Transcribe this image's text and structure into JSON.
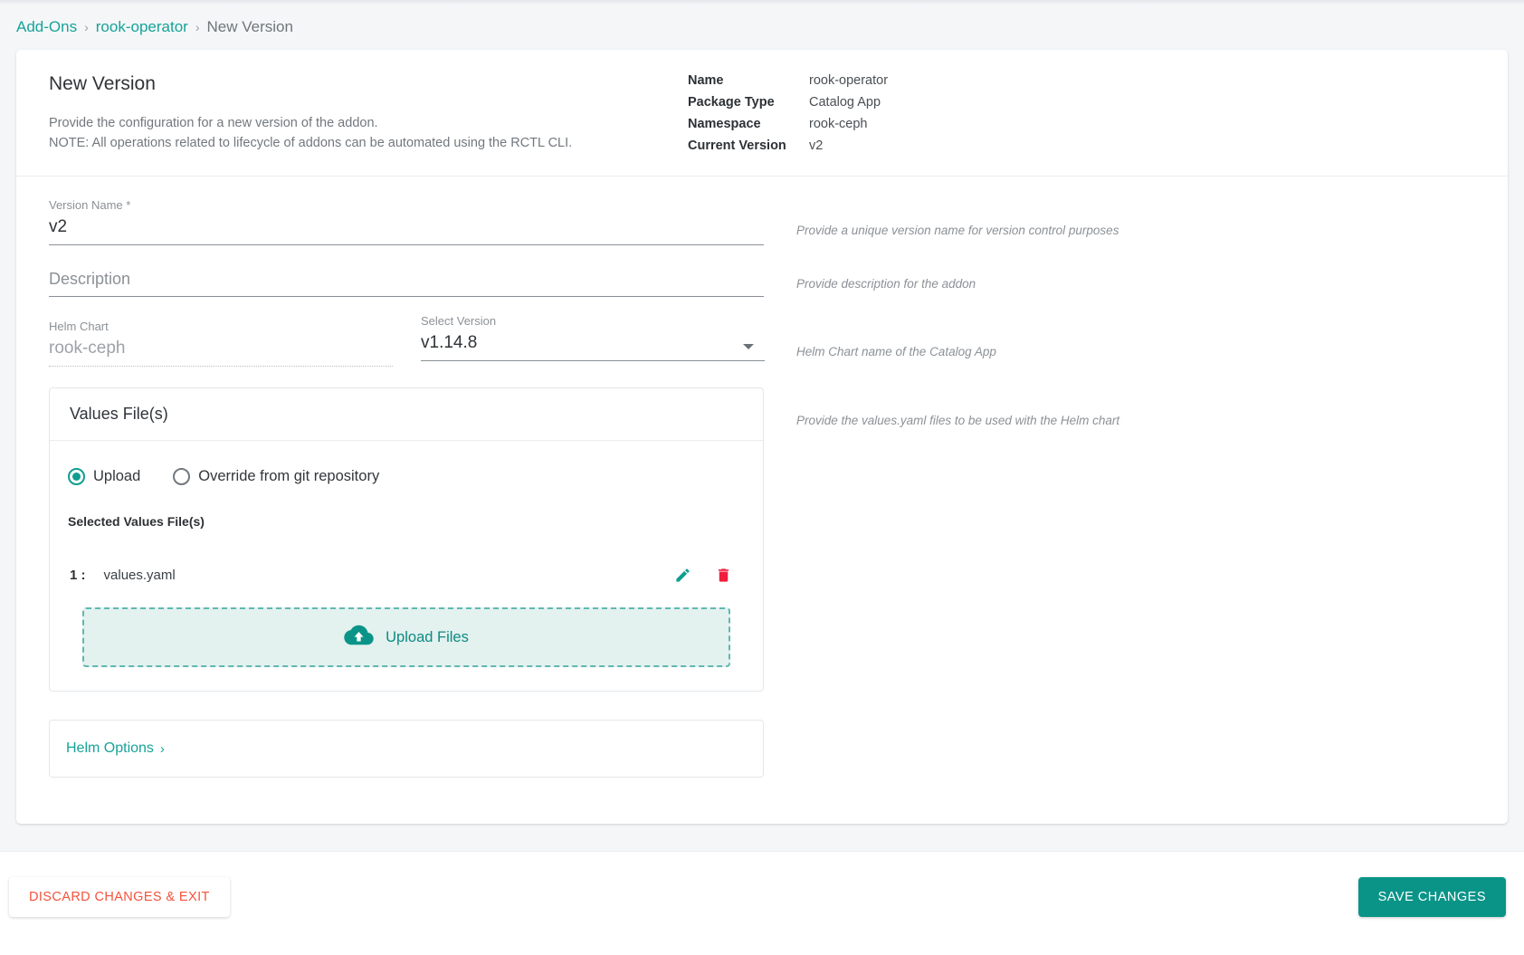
{
  "breadcrumb": {
    "items": [
      {
        "label": "Add-Ons",
        "type": "link"
      },
      {
        "label": "rook-operator",
        "type": "link"
      },
      {
        "label": "New Version",
        "type": "current"
      }
    ],
    "separator": "›"
  },
  "header": {
    "title": "New Version",
    "description_line1": "Provide the configuration for a new version of the addon.",
    "description_line2": "NOTE: All operations related to lifecycle of addons can be automated using the RCTL CLI.",
    "meta": [
      {
        "key": "Name",
        "value": "rook-operator"
      },
      {
        "key": "Package Type",
        "value": "Catalog App"
      },
      {
        "key": "Namespace",
        "value": "rook-ceph"
      },
      {
        "key": "Current Version",
        "value": "v2"
      }
    ]
  },
  "form": {
    "version_name": {
      "label": "Version Name *",
      "value": "v2",
      "placeholder": "",
      "hint": "Provide a unique version name for version control purposes"
    },
    "description": {
      "label": "",
      "value": "",
      "placeholder": "Description",
      "hint": "Provide description for the addon"
    },
    "helm_chart": {
      "label": "Helm Chart",
      "value": "rook-ceph",
      "disabled": true
    },
    "select_version": {
      "label": "Select Version",
      "value": "v1.14.8",
      "caret_icon": "chevron-down-icon",
      "hint": "Helm Chart name of the Catalog App"
    },
    "values_files": {
      "title": "Values File(s)",
      "hint": "Provide the values.yaml files to be used with the Helm chart",
      "source_options": [
        {
          "label": "Upload",
          "selected": true
        },
        {
          "label": "Override from git repository",
          "selected": false
        }
      ],
      "selected_title": "Selected Values File(s)",
      "files": [
        {
          "index": "1 :",
          "name": "values.yaml",
          "edit_icon": "pencil-icon",
          "delete_icon": "trash-icon"
        }
      ],
      "upload": {
        "label": "Upload Files",
        "icon": "cloud-upload-icon"
      }
    },
    "helm_options": {
      "label": "Helm Options",
      "chevron": "›"
    }
  },
  "footer": {
    "discard_label": "DISCARD CHANGES & EXIT",
    "save_label": "SAVE CHANGES"
  },
  "colors": {
    "accent": "#0a9488",
    "link": "#17a398",
    "danger": "#f4523b",
    "trash": "#f01e3c",
    "dropzone_bg": "#e3f1ef"
  }
}
